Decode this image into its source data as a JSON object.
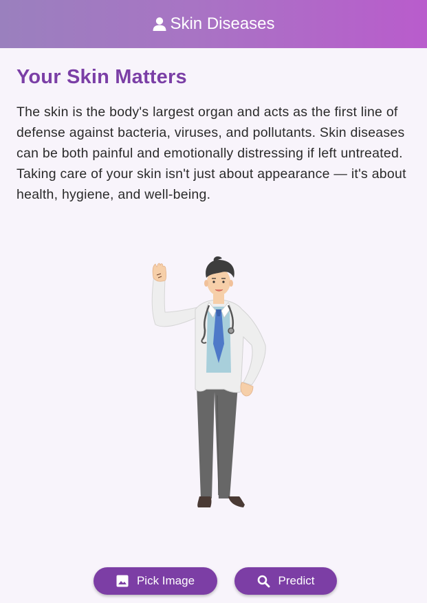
{
  "appbar": {
    "title": "Skin Diseases",
    "icon": "user-icon",
    "gradient": [
      "#9a80be",
      "#b95ccc"
    ]
  },
  "content": {
    "heading": "Your Skin Matters",
    "body": "The skin is the body's largest organ and acts as the first line of defense against bacteria, viruses, and pollutants. Skin diseases can be both painful and emotionally distressing if left untreated. Taking care of your skin isn't just about appearance — it's about health, hygiene, and well-being.",
    "illustration": "doctor-illustration"
  },
  "actions": {
    "pick_label": "Pick Image",
    "pick_icon": "image-icon",
    "predict_label": "Predict",
    "predict_icon": "search-icon"
  },
  "colors": {
    "accent": "#7c3ea5",
    "heading": "#7b3fa6",
    "background": "#f8f4fb"
  }
}
